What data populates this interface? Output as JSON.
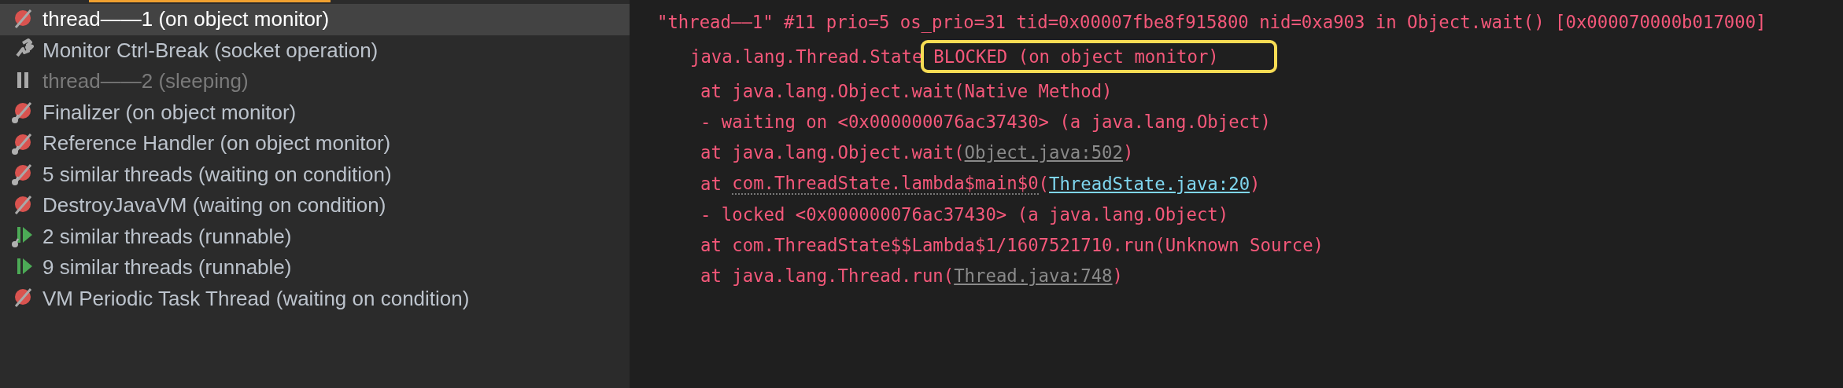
{
  "threads": [
    {
      "label": "thread——1 (on object monitor)",
      "kind": "monitor",
      "daemon": false,
      "selected": true,
      "disabled": false
    },
    {
      "label": "Monitor Ctrl-Break (socket operation)",
      "kind": "socket",
      "daemon": false,
      "selected": false,
      "disabled": false
    },
    {
      "label": "thread——2 (sleeping)",
      "kind": "sleeping",
      "daemon": false,
      "selected": false,
      "disabled": true
    },
    {
      "label": "Finalizer (on object monitor)",
      "kind": "monitor",
      "daemon": true,
      "selected": false,
      "disabled": false
    },
    {
      "label": "Reference Handler (on object monitor)",
      "kind": "monitor",
      "daemon": true,
      "selected": false,
      "disabled": false
    },
    {
      "label": "5 similar threads (waiting on condition)",
      "kind": "monitor",
      "daemon": true,
      "selected": false,
      "disabled": false
    },
    {
      "label": "DestroyJavaVM (waiting on condition)",
      "kind": "monitor",
      "daemon": false,
      "selected": false,
      "disabled": false
    },
    {
      "label": "2 similar threads (runnable)",
      "kind": "running",
      "daemon": true,
      "selected": false,
      "disabled": false
    },
    {
      "label": "9 similar threads (runnable)",
      "kind": "running",
      "daemon": false,
      "selected": false,
      "disabled": false
    },
    {
      "label": "VM Periodic Task Thread (waiting on condition)",
      "kind": "monitor",
      "daemon": false,
      "selected": false,
      "disabled": false
    }
  ],
  "stack_trace": [
    {
      "kind": "header",
      "segments": [
        {
          "text": "\"thread——1\" #11 prio=5 os_prio=31 tid=0x00007fbe8f915800 nid=0xa903 in Object.wait() [0x000070000b017000]",
          "kind": "plain"
        }
      ]
    },
    {
      "kind": "state",
      "segments": [
        {
          "text": "java.lang.Thread.State",
          "kind": "plain"
        },
        {
          "text": "BLOCKED (on object monitor)",
          "kind": "boxed"
        }
      ]
    },
    {
      "kind": "frame",
      "segments": [
        {
          "text": "at java.lang.Object.wait(Native Method)",
          "kind": "plain"
        }
      ]
    },
    {
      "kind": "frame",
      "segments": [
        {
          "text": "- waiting on <0x000000076ac37430> (a java.lang.Object)",
          "kind": "plain"
        }
      ]
    },
    {
      "kind": "frame",
      "segments": [
        {
          "text": "at java.lang.Object.wait(",
          "kind": "plain"
        },
        {
          "text": "Object.java:502",
          "kind": "library"
        },
        {
          "text": ")",
          "kind": "plain"
        }
      ]
    },
    {
      "kind": "frame",
      "segments": [
        {
          "text": "at ",
          "kind": "plain"
        },
        {
          "text": "com.ThreadState.lambda$main$0",
          "kind": "dotted"
        },
        {
          "text": "(",
          "kind": "plain"
        },
        {
          "text": "ThreadState.java:20",
          "kind": "source"
        },
        {
          "text": ")",
          "kind": "plain"
        }
      ]
    },
    {
      "kind": "frame",
      "segments": [
        {
          "text": "- locked <0x000000076ac37430> (a java.lang.Object)",
          "kind": "plain"
        }
      ]
    },
    {
      "kind": "frame",
      "segments": [
        {
          "text": "at com.ThreadState$$Lambda$1/1607521710.run(Unknown Source)",
          "kind": "plain"
        }
      ]
    },
    {
      "kind": "frame",
      "segments": [
        {
          "text": "at java.lang.Thread.run(",
          "kind": "plain"
        },
        {
          "text": "Thread.java:748",
          "kind": "library"
        },
        {
          "text": ")",
          "kind": "plain"
        }
      ]
    }
  ]
}
